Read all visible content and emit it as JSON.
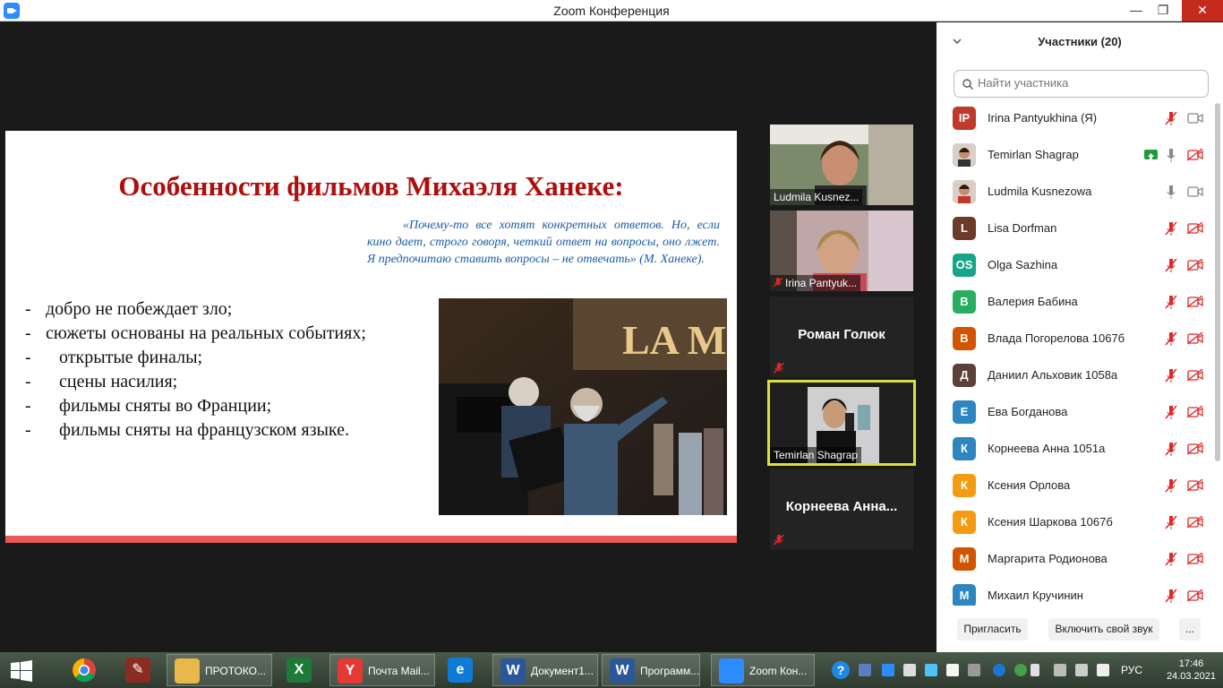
{
  "window": {
    "title": "Zoom Конференция",
    "min_label": "—",
    "max_label": "❐",
    "close_label": "✕"
  },
  "slide": {
    "title": "Особенности фильмов Михаэля Ханеке:",
    "quote": "«Почему-то все хотят конкретных ответов. Но, если кино дает, строго говоря, четкий ответ на вопросы, оно лжет. Я предпочитаю ставить вопросы – не отвечать» (М. Ханеке).",
    "bullets": [
      "добро не побеждает зло;",
      "сюжеты основаны на реальных событиях;",
      "открытые финалы;",
      "сцены насилия;",
      "фильмы сняты во Франции;",
      "фильмы сняты на французском языке."
    ],
    "bullet_dash": "-",
    "photo_sign": "LA MOMIE"
  },
  "video_tiles": [
    {
      "name": "Ludmila Kusnez..."
    },
    {
      "name": "Irina Pantyuk..."
    },
    {
      "name": "Роман Голюк"
    },
    {
      "name": "Temirlan Shagrap"
    },
    {
      "name": "Корнеева  Анна..."
    }
  ],
  "participants_panel": {
    "title": "Участники (20)",
    "search_placeholder": "Найти участника",
    "participants": [
      {
        "initials": "IP",
        "name": "Irina Pantyukhina (Я)",
        "color": "#c0392b",
        "mic": "muted",
        "cam": "on"
      },
      {
        "initials": "",
        "name": "Temirlan Shagrap",
        "color": "#8a6d5a",
        "mic": "on",
        "cam": "off",
        "sharing": true
      },
      {
        "initials": "",
        "name": "Ludmila Kusnezowa",
        "color": "#a55",
        "mic": "on",
        "cam": "on"
      },
      {
        "initials": "L",
        "name": "Lisa Dorfman",
        "color": "#6d3b2a",
        "mic": "muted",
        "cam": "off"
      },
      {
        "initials": "OS",
        "name": "Olga Sazhina",
        "color": "#17a589",
        "mic": "muted",
        "cam": "off"
      },
      {
        "initials": "В",
        "name": "Валерия Бабина",
        "color": "#27ae60",
        "mic": "muted",
        "cam": "off"
      },
      {
        "initials": "В",
        "name": "Влада Погорелова 1067б",
        "color": "#d35400",
        "mic": "muted",
        "cam": "off"
      },
      {
        "initials": "Д",
        "name": "Даниил Альховик 1058а",
        "color": "#5d4037",
        "mic": "muted",
        "cam": "off"
      },
      {
        "initials": "Е",
        "name": "Ева Богданова",
        "color": "#2e86c1",
        "mic": "muted",
        "cam": "off"
      },
      {
        "initials": "К",
        "name": "Корнеева Анна 1051а",
        "color": "#2e86c1",
        "mic": "muted",
        "cam": "off"
      },
      {
        "initials": "К",
        "name": "Ксения Орлова",
        "color": "#f39c12",
        "mic": "muted",
        "cam": "off"
      },
      {
        "initials": "К",
        "name": "Ксения Шаркова 1067б",
        "color": "#f39c12",
        "mic": "muted",
        "cam": "off"
      },
      {
        "initials": "М",
        "name": "Маргарита Родионова",
        "color": "#d35400",
        "mic": "muted",
        "cam": "off"
      },
      {
        "initials": "М",
        "name": "Михаил Кручинин",
        "color": "#2e86c1",
        "mic": "muted",
        "cam": "off"
      }
    ],
    "invite_label": "Пригласить",
    "unmute_label": "Включить свой звук",
    "more_label": "..."
  },
  "taskbar": {
    "apps": [
      {
        "name": "ПРОТОКО...",
        "color": "#e8b84a"
      },
      {
        "name": "",
        "color": "#1f7a3a",
        "letter": "X"
      },
      {
        "name": "Почта Mail...",
        "color": "#e53935",
        "letter": "Y"
      },
      {
        "name": "",
        "color": "#0f7bd6",
        "letter": "e"
      },
      {
        "name": "Документ1...",
        "color": "#2b579a",
        "letter": "W"
      },
      {
        "name": "Программ...",
        "color": "#2b579a",
        "letter": "W"
      },
      {
        "name": "Zoom Кон...",
        "color": "#2d8cff",
        "letter": ""
      }
    ],
    "lang": "РУС",
    "time": "17:46",
    "date": "24.03.2021"
  },
  "colors": {
    "slide_title": "#b00d0d",
    "quote": "#1c5ca3",
    "active_speaker": "#d8e23a",
    "muted": "#e02828"
  }
}
